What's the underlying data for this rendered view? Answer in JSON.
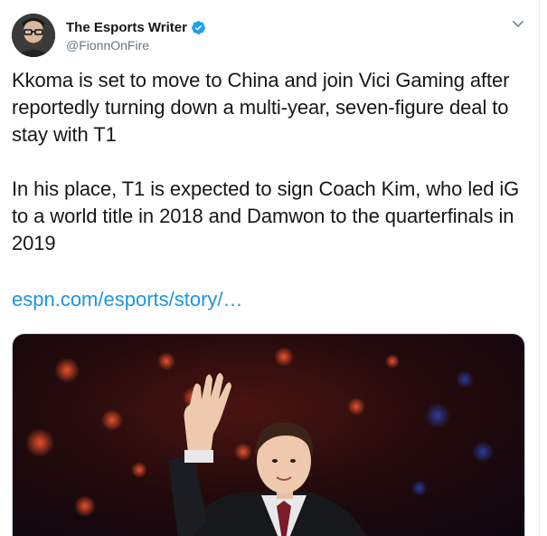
{
  "author": {
    "display_name": "The Esports Writer",
    "handle": "@FionnOnFire",
    "verified": true
  },
  "icons": {
    "avatar": "person-with-glasses-avatar",
    "verified": "verified-badge-icon",
    "menu": "chevron-down-icon"
  },
  "tweet": {
    "text": "Kkoma is set to move to China and join Vici Gaming after reportedly turning down a multi-year, seven-figure deal to stay with T1\n\nIn his place, T1 is expected to sign Coach Kim, who led iG to a world title in 2018 and Damwon to the quarterfinals in 2019",
    "link": "espn.com/esports/story/…"
  },
  "colors": {
    "link": "#1b95e0",
    "verified": "#1da1f2",
    "secondary_text": "#657786"
  }
}
